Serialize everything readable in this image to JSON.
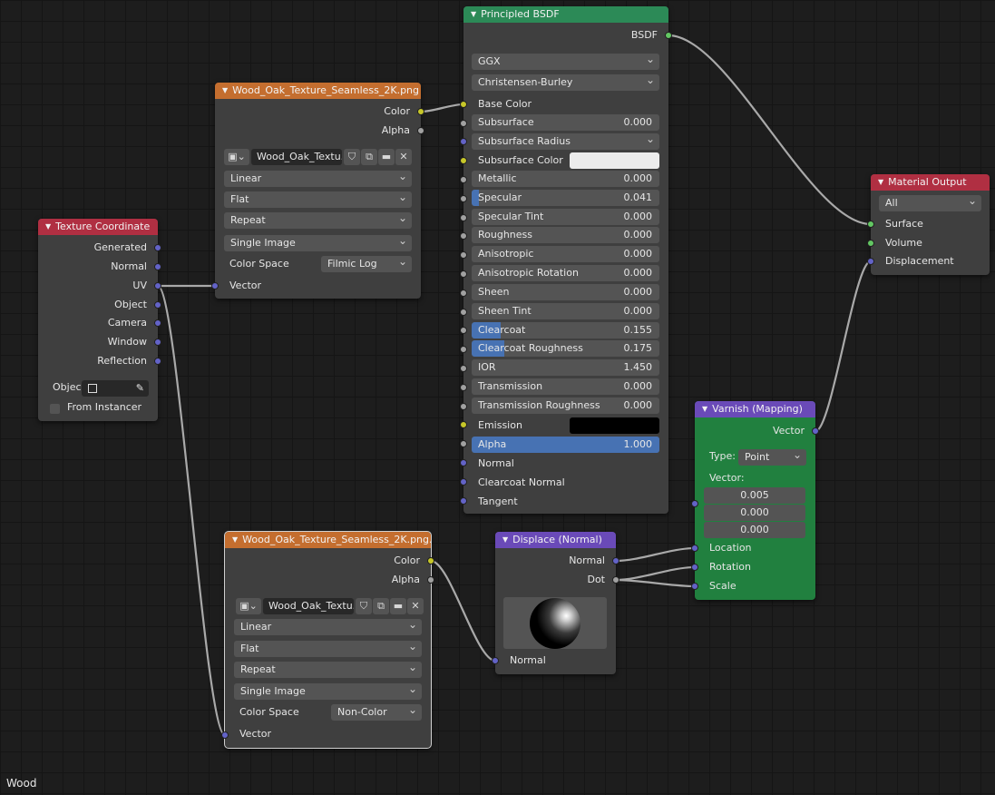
{
  "editor_label": "Wood",
  "nodes": {
    "texture_coordinate": {
      "title": "Texture Coordinate",
      "outputs": [
        "Generated",
        "Normal",
        "UV",
        "Object",
        "Camera",
        "Window",
        "Reflection"
      ],
      "object_label": "Objec",
      "from_instancer": "From Instancer"
    },
    "image_tex_1": {
      "title": "Wood_Oak_Texture_Seamless_2K.png",
      "outputs": [
        "Color",
        "Alpha"
      ],
      "image_name": "Wood_Oak_Textu..",
      "interpolation": "Linear",
      "projection": "Flat",
      "extension": "Repeat",
      "source": "Single Image",
      "color_space_label": "Color Space",
      "color_space": "Filmic Log",
      "input": "Vector"
    },
    "image_tex_2": {
      "title": "Wood_Oak_Texture_Seamless_2K.png...",
      "outputs": [
        "Color",
        "Alpha"
      ],
      "image_name": "Wood_Oak_Textu..",
      "interpolation": "Linear",
      "projection": "Flat",
      "extension": "Repeat",
      "source": "Single Image",
      "color_space_label": "Color Space",
      "color_space": "Non-Color",
      "input": "Vector"
    },
    "principled": {
      "title": "Principled BSDF",
      "output": "BSDF",
      "distribution": "GGX",
      "subsurface_method": "Christensen-Burley",
      "base_color": "Base Color",
      "subsurface_radius": "Subsurface Radius",
      "subsurface_color": "Subsurface Color",
      "subsurface_color_value": "#ececec",
      "emission": "Emission",
      "emission_color_value": "#000000",
      "params": [
        {
          "label": "Subsurface",
          "value": "0.000",
          "fill": 0
        },
        {
          "label": "Metallic",
          "value": "0.000",
          "fill": 0
        },
        {
          "label": "Specular",
          "value": "0.041",
          "fill": 0.041
        },
        {
          "label": "Specular Tint",
          "value": "0.000",
          "fill": 0
        },
        {
          "label": "Roughness",
          "value": "0.000",
          "fill": 0
        },
        {
          "label": "Anisotropic",
          "value": "0.000",
          "fill": 0
        },
        {
          "label": "Anisotropic Rotation",
          "value": "0.000",
          "fill": 0
        },
        {
          "label": "Sheen",
          "value": "0.000",
          "fill": 0
        },
        {
          "label": "Sheen Tint",
          "value": "0.000",
          "fill": 0
        },
        {
          "label": "Clearcoat",
          "value": "0.155",
          "fill": 0.155
        },
        {
          "label": "Clearcoat Roughness",
          "value": "0.175",
          "fill": 0.175
        },
        {
          "label": "IOR",
          "value": "1.450",
          "fill": 0
        },
        {
          "label": "Transmission",
          "value": "0.000",
          "fill": 0
        },
        {
          "label": "Transmission Roughness",
          "value": "0.000",
          "fill": 0
        }
      ],
      "alpha": {
        "label": "Alpha",
        "value": "1.000",
        "fill": 1
      },
      "normal": "Normal",
      "clearcoat_normal": "Clearcoat Normal",
      "tangent": "Tangent"
    },
    "material_output": {
      "title": "Material Output",
      "target": "All",
      "inputs": [
        "Surface",
        "Volume",
        "Displacement"
      ]
    },
    "mapping": {
      "title": "Varnish (Mapping)",
      "output": "Vector",
      "type_label": "Type:",
      "type_value": "Point",
      "vector_label": "Vector:",
      "vector_values": [
        "0.005",
        "0.000",
        "0.000"
      ],
      "inputs": [
        "Location",
        "Rotation",
        "Scale"
      ]
    },
    "displace": {
      "title": "Displace (Normal)",
      "outputs": [
        "Normal",
        "Dot"
      ],
      "input": "Normal"
    }
  },
  "colors": {
    "image_header": "#c46e2f",
    "texcoord_header": "#b02f42",
    "shader_header": "#2c8a57",
    "vector_header": "#6a4ab8",
    "value_fill": "#4772b3",
    "wire": "#a9a9a9"
  }
}
